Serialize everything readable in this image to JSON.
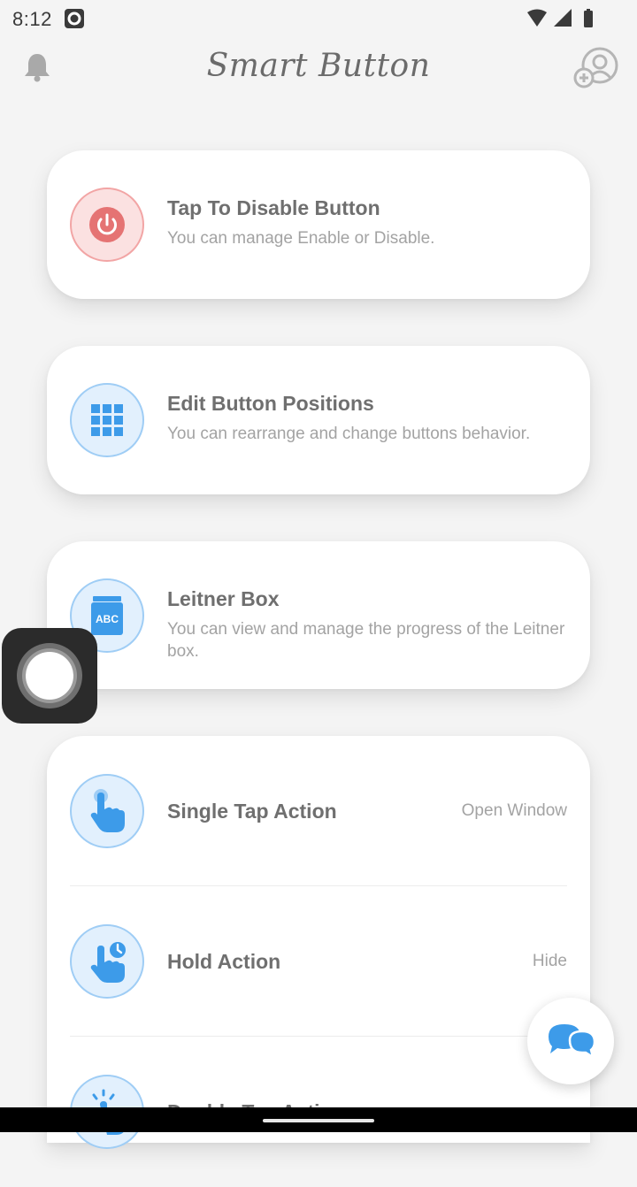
{
  "status_bar": {
    "time": "8:12"
  },
  "app": {
    "title": "Smart Button"
  },
  "cards": [
    {
      "title": "Tap To Disable Button",
      "description": "You can manage Enable or Disable.",
      "icon": "power-icon",
      "color": "#e57373"
    },
    {
      "title": "Edit Button Positions",
      "description": "You can rearrange and change buttons behavior.",
      "icon": "grid-icon",
      "color": "#3d9be9"
    },
    {
      "title": "Leitner Box",
      "description": "You can view and manage the progress of the Leitner box.",
      "icon": "abc-box-icon",
      "icon_text": "ABC",
      "color": "#3d9be9"
    }
  ],
  "actions": [
    {
      "title": "Single Tap Action",
      "value": "Open Window",
      "icon": "tap-hand-icon"
    },
    {
      "title": "Hold Action",
      "value": "Hide",
      "icon": "hold-hand-icon"
    },
    {
      "title": "Double Tap Action",
      "value": "",
      "icon": "double-tap-hand-icon"
    }
  ],
  "colors": {
    "accent_blue": "#3d9be9",
    "accent_red": "#e57373",
    "background": "#f4f4f4"
  }
}
